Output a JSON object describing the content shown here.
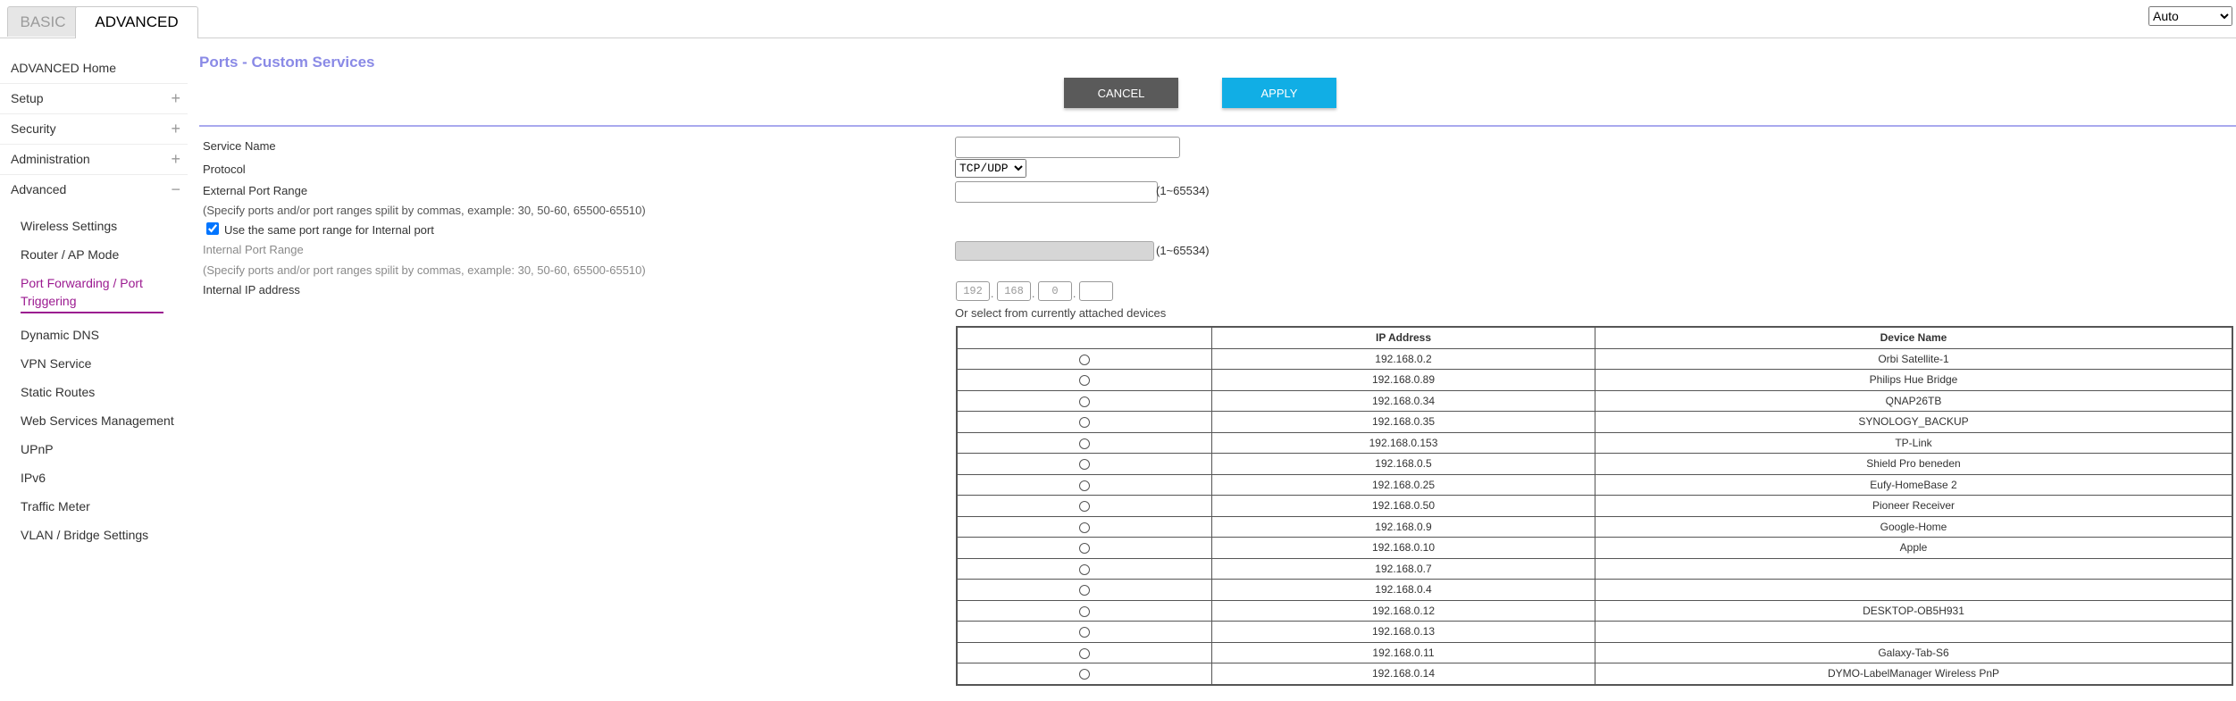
{
  "tabs": {
    "basic": "BASIC",
    "advanced": "ADVANCED"
  },
  "language": {
    "selected": "Auto"
  },
  "sidebar": {
    "items": [
      {
        "label": "ADVANCED Home",
        "expand": ""
      },
      {
        "label": "Setup",
        "expand": "+"
      },
      {
        "label": "Security",
        "expand": "+"
      },
      {
        "label": "Administration",
        "expand": "+"
      },
      {
        "label": "Advanced",
        "expand": "−"
      }
    ],
    "sub_items": [
      "Wireless Settings",
      "Router / AP Mode",
      "Port Forwarding / Port Triggering",
      "Dynamic DNS",
      "VPN Service",
      "Static Routes",
      "Web Services Management",
      "UPnP",
      "IPv6",
      "Traffic Meter",
      "VLAN / Bridge Settings"
    ]
  },
  "page": {
    "title": "Ports - Custom Services",
    "cancel": "CANCEL",
    "apply": "APPLY"
  },
  "form": {
    "service_name_label": "Service Name",
    "service_name_value": "",
    "protocol_label": "Protocol",
    "protocol_value": "TCP/UDP",
    "external_port_label": "External Port Range",
    "external_port_value": "",
    "external_range_hint": "(1~65534)",
    "external_hint": "(Specify ports and/or port ranges spilit by commas, example: 30, 50-60, 65500-65510)",
    "same_port_label": "Use the same port range for Internal port",
    "same_port_checked": true,
    "internal_port_label": "Internal Port Range",
    "internal_range_hint": "(1~65534)",
    "internal_hint": "(Specify ports and/or port ranges spilit by commas, example: 30, 50-60, 65500-65510)",
    "internal_ip_label": "Internal IP address",
    "ip_octets": [
      "192",
      "168",
      "0",
      ""
    ],
    "or_select": "Or select from currently attached devices"
  },
  "devices": {
    "headers": [
      "",
      "IP Address",
      "Device Name"
    ],
    "rows": [
      {
        "ip": "192.168.0.2",
        "name": "Orbi Satellite-1"
      },
      {
        "ip": "192.168.0.89",
        "name": "Philips Hue Bridge"
      },
      {
        "ip": "192.168.0.34",
        "name": "QNAP26TB"
      },
      {
        "ip": "192.168.0.35",
        "name": "SYNOLOGY_BACKUP"
      },
      {
        "ip": "192.168.0.153",
        "name": "TP-Link"
      },
      {
        "ip": "192.168.0.5",
        "name": "Shield Pro beneden"
      },
      {
        "ip": "192.168.0.25",
        "name": "Eufy-HomeBase 2"
      },
      {
        "ip": "192.168.0.50",
        "name": "Pioneer Receiver"
      },
      {
        "ip": "192.168.0.9",
        "name": "Google-Home"
      },
      {
        "ip": "192.168.0.10",
        "name": "Apple"
      },
      {
        "ip": "192.168.0.7",
        "name": ""
      },
      {
        "ip": "192.168.0.4",
        "name": ""
      },
      {
        "ip": "192.168.0.12",
        "name": "DESKTOP-OB5H931"
      },
      {
        "ip": "192.168.0.13",
        "name": ""
      },
      {
        "ip": "192.168.0.11",
        "name": "Galaxy-Tab-S6"
      },
      {
        "ip": "192.168.0.14",
        "name": "DYMO-LabelManager Wireless PnP"
      }
    ]
  }
}
